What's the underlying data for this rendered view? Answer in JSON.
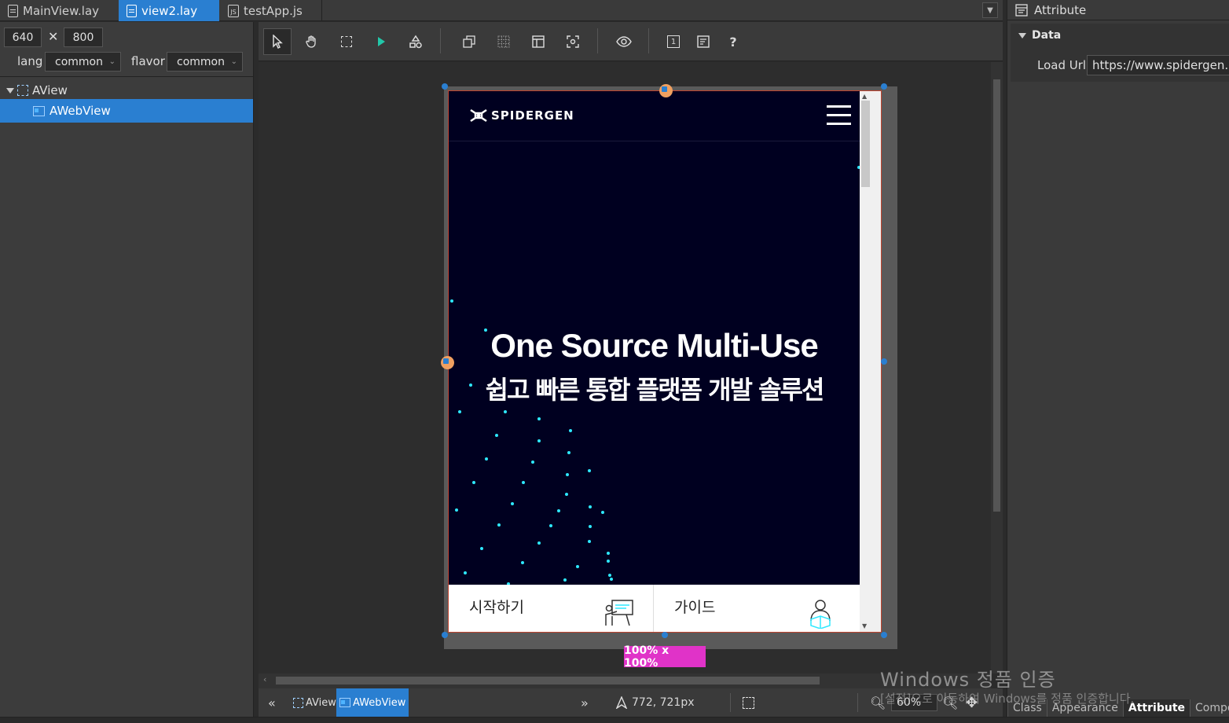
{
  "tabs": [
    {
      "label": "MainView.lay",
      "icon": "file-icon"
    },
    {
      "label": "view2.lay",
      "icon": "file-icon",
      "active": true
    },
    {
      "label": "testApp.js",
      "icon": "js-file-icon"
    }
  ],
  "left": {
    "width": "640",
    "height": "800",
    "times": "✕",
    "lang_label": "lang",
    "lang_value": "common",
    "flavor_label": "flavor",
    "flavor_value": "common",
    "tree": [
      {
        "label": "AView",
        "icon": "view-icon"
      },
      {
        "label": "AWebView",
        "icon": "webview-icon",
        "selected": true
      }
    ]
  },
  "toolbar": {
    "icons": [
      "select-pointer-icon",
      "pan-hand-icon",
      "marquee-select-icon",
      "play-icon",
      "shapes-icon",
      "layers-icon",
      "grid-icon",
      "layout-icon",
      "fit-icon",
      "preview-eye-icon",
      "number-icon",
      "notes-icon",
      "help-icon"
    ],
    "help_label": "?",
    "number_label": "1"
  },
  "webview": {
    "logo_text": "SPIDERGEN",
    "headline": "One Source Multi-Use",
    "subline": "쉽고 빠른 통합 플랫폼 개발 솔루션",
    "bottom_items": [
      {
        "label": "시작하기",
        "icon": "presentation-icon"
      },
      {
        "label": "가이드",
        "icon": "user-guide-icon"
      }
    ],
    "accent": "#2ee8ff",
    "background": "#000020"
  },
  "size_badge": "100% x 100%",
  "status": {
    "crumbs": [
      "AView",
      "AWebView"
    ],
    "coords": "772, 721px",
    "zoom": "60%"
  },
  "right": {
    "title": "Attribute",
    "section": "Data",
    "load_url_label": "Load Url",
    "load_url_value": "https://www.spidergen.c",
    "tabs": [
      "Class",
      "Appearance",
      "Attribute",
      "Compon"
    ],
    "active_tab": "Attribute"
  },
  "watermark": {
    "line1": "Windows 정품 인증",
    "line2": "[설정]으로 이동하여 Windows를 정품 인증합니다."
  }
}
